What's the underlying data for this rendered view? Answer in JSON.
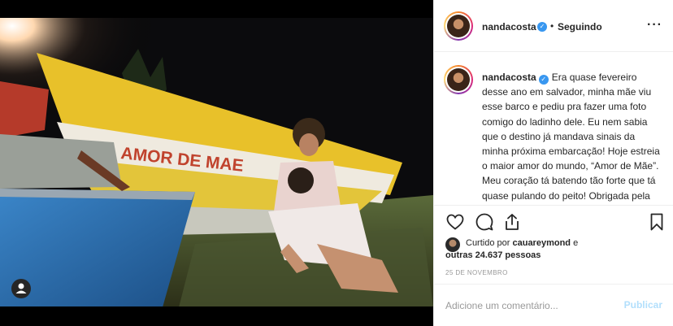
{
  "post": {
    "username": "nandacosta",
    "verified_icon": "verified-badge-icon",
    "follow_status": "Seguindo",
    "more_icon": "more-options-icon",
    "boat_text": "AMOR DE MAE",
    "caption": "Era quase fevereiro desse ano em salvador, minha mãe viu esse barco e pediu pra fazer uma foto comigo do ladinho dele. Eu nem sabia que o destino já mandava sinais da minha próxima embarcação! Hoje estreia o maior amor do mundo, “Amor de Mãe”. Meu coração tá batendo tão forte que tá quase pulando do peito! Obrigada pela vida,",
    "liked_by_prefix": "Curtido por",
    "liked_by_user": "cauareymond",
    "liked_by_suffix": "e",
    "others_count": "outras 24.637 pessoas",
    "date": "25 DE NOVEMBRO"
  },
  "comment": {
    "placeholder": "Adicione um comentário...",
    "publish_label": "Publicar"
  },
  "colors": {
    "accent_blue": "#3897f0",
    "publish_disabled": "#b2dffc",
    "boat_yellow": "#e8c12a",
    "boat_blue": "#2f74b8"
  }
}
